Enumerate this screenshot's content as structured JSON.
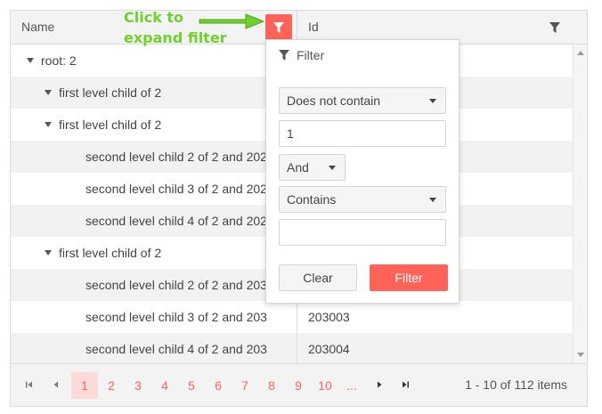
{
  "header": {
    "name_label": "Name",
    "id_label": "Id"
  },
  "annotation": {
    "line1": "Click to",
    "line2": "expand filter"
  },
  "rows": [
    {
      "indent": 0,
      "expanded": true,
      "name": "root: 2",
      "id": ""
    },
    {
      "indent": 1,
      "expanded": true,
      "name": "first level child of 2",
      "id": ""
    },
    {
      "indent": 1,
      "expanded": true,
      "name": "first level child of 2",
      "id": ""
    },
    {
      "indent": 2,
      "expanded": false,
      "name": "second level child 2 of 2 and 202",
      "id": ""
    },
    {
      "indent": 2,
      "expanded": false,
      "name": "second level child 3 of 2 and 202",
      "id": ""
    },
    {
      "indent": 2,
      "expanded": false,
      "name": "second level child 4 of 2 and 202",
      "id": ""
    },
    {
      "indent": 1,
      "expanded": true,
      "name": "first level child of 2",
      "id": ""
    },
    {
      "indent": 2,
      "expanded": false,
      "name": "second level child 2 of 2 and 203",
      "id": ""
    },
    {
      "indent": 2,
      "expanded": false,
      "name": "second level child 3 of 2 and 203",
      "id": "203003"
    },
    {
      "indent": 2,
      "expanded": false,
      "name": "second level child 4 of 2 and 203",
      "id": "203004"
    }
  ],
  "filter_menu": {
    "title": "Filter",
    "operator1": "Does not contain",
    "value1": "1",
    "logic": "And",
    "operator2": "Contains",
    "value2": "",
    "clear_label": "Clear",
    "apply_label": "Filter"
  },
  "pager": {
    "pages": [
      "1",
      "2",
      "3",
      "4",
      "5",
      "6",
      "7",
      "8",
      "9",
      "10",
      "..."
    ],
    "selected_page": "1",
    "info": "1 - 10 of 112 items"
  },
  "colors": {
    "accent": "#ff6358",
    "selected_page_bg": "#fbdad8",
    "annotation": "#6fd12b",
    "header_bg": "#f3f3f3",
    "alt_row_bg": "#f2f2f2"
  }
}
